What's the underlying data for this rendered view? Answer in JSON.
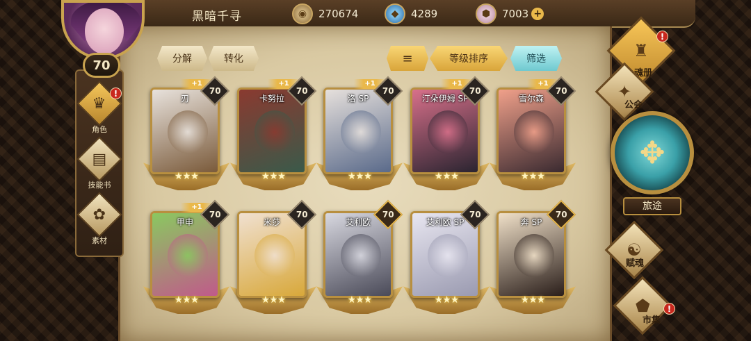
{
  "player": {
    "name": "黑暗千寻",
    "level": "70"
  },
  "currencies": [
    {
      "icon": "gold-coin-icon",
      "value": "270674"
    },
    {
      "icon": "blue-crystal-icon",
      "value": "4289"
    },
    {
      "icon": "pink-gem-icon",
      "value": "7003"
    }
  ],
  "left_nav": [
    {
      "label": "角色",
      "icon": "character-icon",
      "active": true,
      "badge": "!"
    },
    {
      "label": "技能书",
      "icon": "skill-book-icon",
      "active": false
    },
    {
      "label": "素材",
      "icon": "material-icon",
      "active": false
    }
  ],
  "toolbar": {
    "decompose": "分解",
    "convert": "转化",
    "sort_icon": "sort-icon",
    "sort": "等级排序",
    "filter": "筛选"
  },
  "cards": [
    {
      "name": "刃",
      "level": "70",
      "plus": "+1",
      "gold": false,
      "colors": [
        "#e8e2dc",
        "#7a5a3a"
      ]
    },
    {
      "name": "卡努拉",
      "level": "70",
      "plus": "+1",
      "gold": false,
      "colors": [
        "#8a3a30",
        "#3a5a4a"
      ]
    },
    {
      "name": "洛 SP",
      "level": "70",
      "plus": "+1",
      "gold": false,
      "colors": [
        "#e6e0dc",
        "#5a6a8a"
      ]
    },
    {
      "name": "汀朵伊姆 SP",
      "level": "70",
      "plus": "+1",
      "gold": false,
      "colors": [
        "#d8708a",
        "#2a2430"
      ]
    },
    {
      "name": "雪尔森",
      "level": "70",
      "plus": "+1",
      "gold": false,
      "colors": [
        "#f0a08a",
        "#3a2a30"
      ]
    },
    {
      "name": "甲申",
      "level": "70",
      "plus": "+1",
      "gold": false,
      "colors": [
        "#8ac860",
        "#c05a8a"
      ]
    },
    {
      "name": "米莎",
      "level": "70",
      "plus": "",
      "gold": false,
      "colors": [
        "#f0e0d0",
        "#d8a83a"
      ]
    },
    {
      "name": "艾利欧",
      "level": "70",
      "plus": "",
      "gold": true,
      "colors": [
        "#d8d8e0",
        "#4a4a58"
      ]
    },
    {
      "name": "艾利欧 SP",
      "level": "70",
      "plus": "",
      "gold": false,
      "colors": [
        "#e8e6f0",
        "#9a9ab0"
      ]
    },
    {
      "name": "奔 SP",
      "level": "70",
      "plus": "",
      "gold": true,
      "colors": [
        "#f0e0c8",
        "#2a1e1a"
      ]
    }
  ],
  "right_nav": {
    "soul_book": "魂册",
    "guild": "公会",
    "journey": "旅途",
    "soul_endow": "赋魂",
    "market": "市集",
    "badge": "!"
  }
}
